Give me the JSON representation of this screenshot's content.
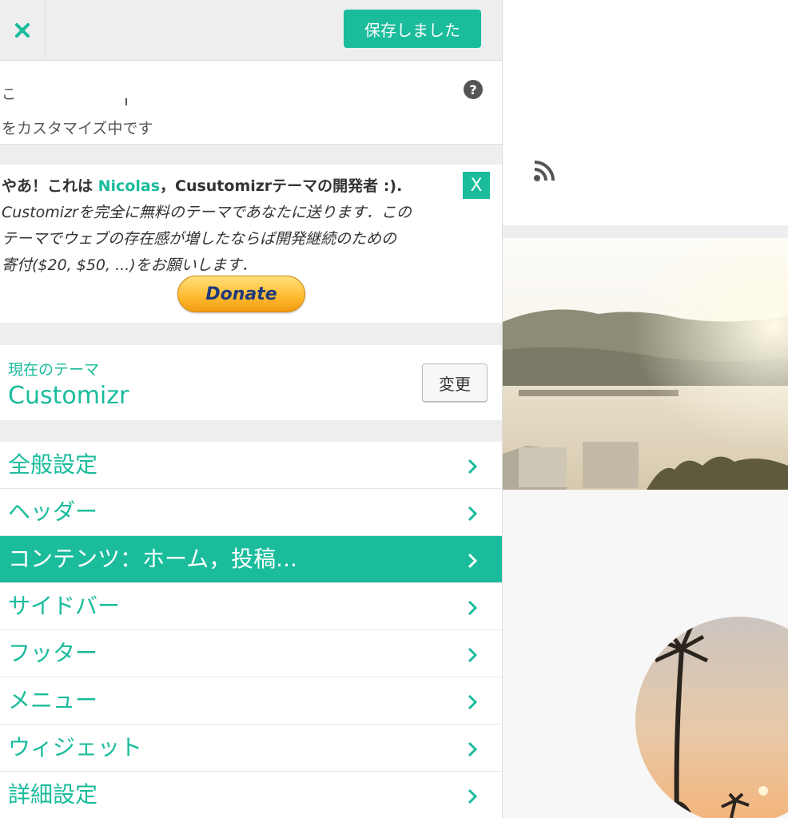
{
  "header": {
    "close_icon": "close-icon",
    "save_label": "保存しました"
  },
  "info": {
    "line1": "こ",
    "line2": "をカスタマイズ中です",
    "help_icon_glyph": "?"
  },
  "donate": {
    "intro_prefix": "やあ！これは ",
    "author": "Nicolas",
    "intro_suffix": "，Cusutomizrテーマの開発者 :).",
    "body_line1": "Customizrを完全に無料のテーマであなたに送ります．この",
    "body_line2": "テーマでウェブの存在感が増したならば開発継続のための",
    "body_line3": "寄付($20, $50, ...)をお願いします．",
    "dismiss_label": "X",
    "button_label": "Donate"
  },
  "theme": {
    "label": "現在のテーマ",
    "name": "Customizr",
    "change_label": "変更"
  },
  "menu": {
    "items": [
      {
        "label": "全般設定",
        "active": false
      },
      {
        "label": "ヘッダー",
        "active": false
      },
      {
        "label": "コンテンツ：ホーム，投稿...",
        "active": true
      },
      {
        "label": "サイドバー",
        "active": false
      },
      {
        "label": "フッター",
        "active": false
      },
      {
        "label": "メニュー",
        "active": false
      },
      {
        "label": "ウィジェット",
        "active": false
      },
      {
        "label": "詳細設定",
        "active": false
      }
    ]
  },
  "preview": {
    "rss_icon": "rss-icon"
  },
  "colors": {
    "accent": "#1abc9c",
    "panel_bg": "#eeeeee"
  }
}
